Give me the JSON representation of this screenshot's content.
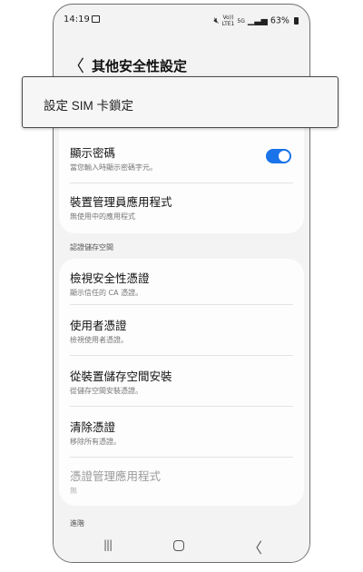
{
  "status_bar": {
    "time": "14:19",
    "volte": "Vo))",
    "lte": "LTE1",
    "signal_5g": "5G",
    "battery": "63%"
  },
  "header": {
    "back_glyph": "〈",
    "title": "其他安全性設定"
  },
  "card1": {
    "show_password": {
      "title": "顯示密碼",
      "subtitle": "當您輸入時顯示密碼字元。",
      "toggle_on": true
    },
    "device_admin": {
      "title": "裝置管理員應用程式",
      "subtitle": "無使用中的應用程式"
    }
  },
  "section_credential_storage": "認證儲存空間",
  "card2": {
    "items": [
      {
        "title": "檢視安全性憑證",
        "subtitle": "顯示信任的 CA 憑證。",
        "disabled": false
      },
      {
        "title": "使用者憑證",
        "subtitle": "檢視使用者憑證。",
        "disabled": false
      },
      {
        "title": "從裝置儲存空間安裝",
        "subtitle": "從儲存空間安裝憑證。",
        "disabled": false
      },
      {
        "title": "清除憑證",
        "subtitle": "移除所有憑證。",
        "disabled": false
      },
      {
        "title": "憑證管理應用程式",
        "subtitle": "無",
        "disabled": true
      }
    ]
  },
  "section_advanced": "進階",
  "nav": {
    "recents_glyph": "|||",
    "back_glyph": "〈"
  },
  "tooltip": {
    "label": "設定 SIM 卡鎖定"
  },
  "colors": {
    "accent": "#1a73e8",
    "background": "#f3f3f3",
    "card": "#fdfdfd"
  }
}
